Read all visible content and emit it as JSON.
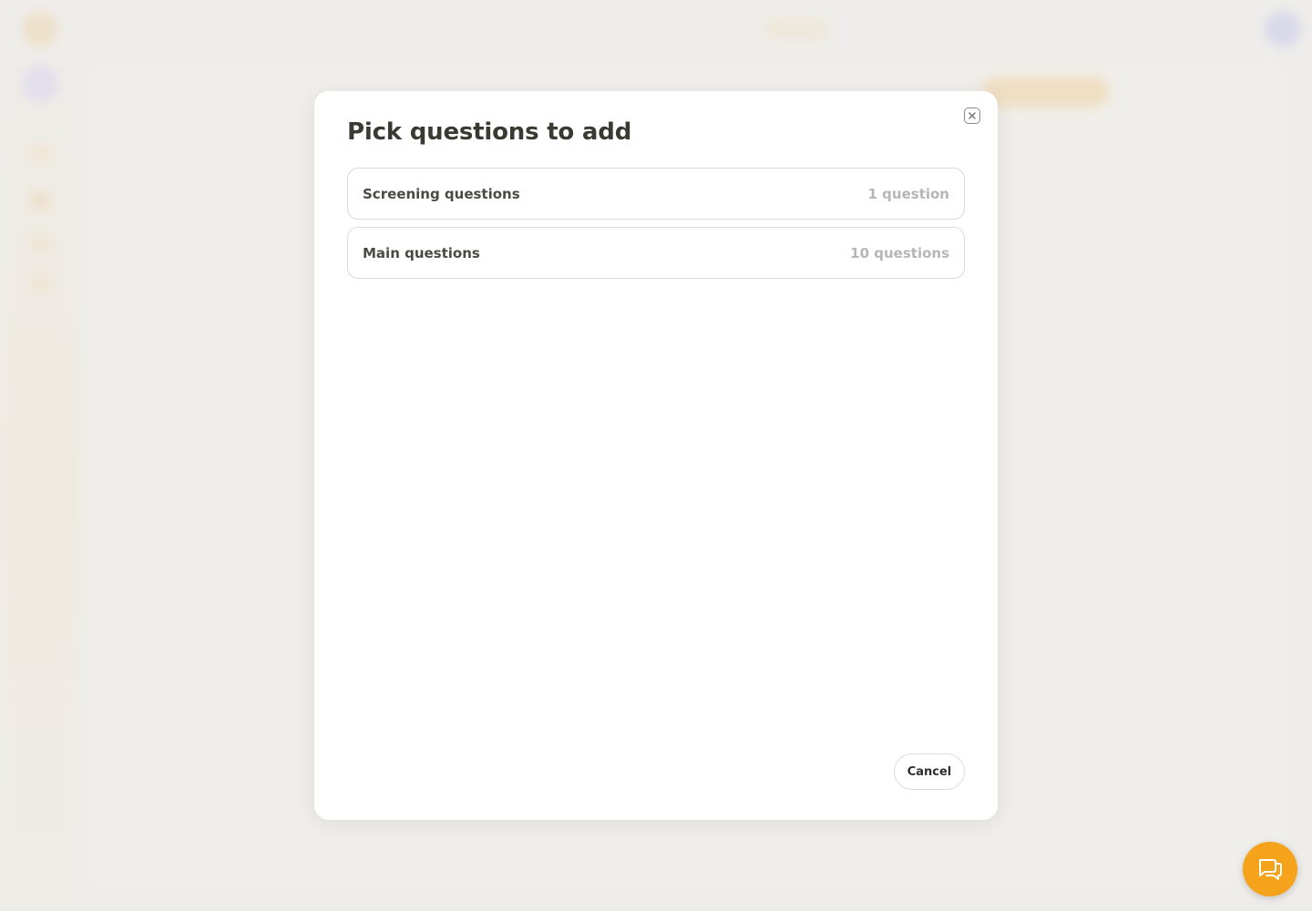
{
  "modal": {
    "title": "Pick questions to add",
    "close_icon": "close-icon",
    "groups": [
      {
        "name": "Screening questions",
        "count": "1 question"
      },
      {
        "name": "Main questions",
        "count": "10 questions"
      }
    ],
    "cancel_label": "Cancel"
  },
  "chat_launcher": {
    "icon": "chat-bubble-icon"
  },
  "colors": {
    "accent": "#f5a31a",
    "title": "#3b3a32",
    "muted": "#b6b6b6"
  }
}
